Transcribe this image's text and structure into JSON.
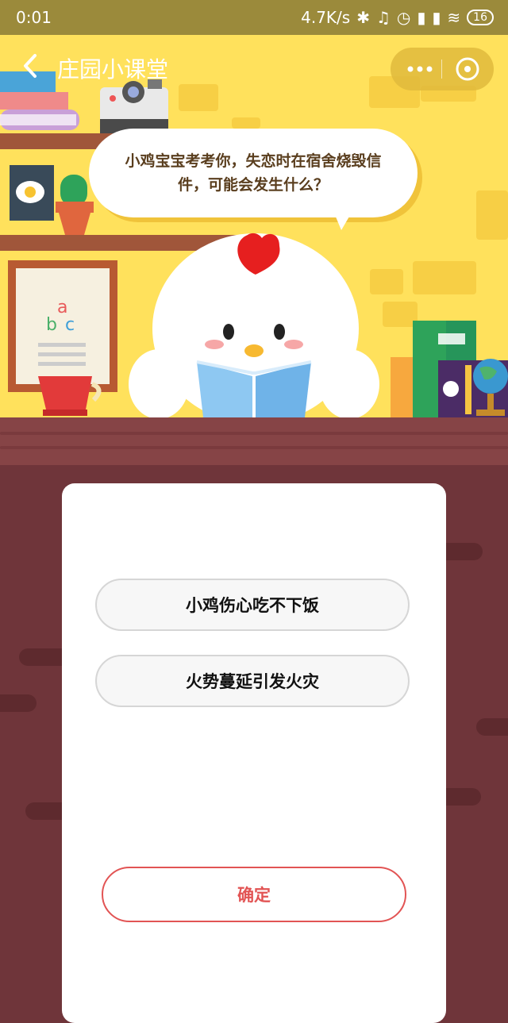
{
  "status_bar": {
    "time": "0:01",
    "network_speed": "4.7K/s",
    "battery": "16"
  },
  "nav": {
    "title": "庄园小课堂"
  },
  "question": {
    "text": "小鸡宝宝考考你，失恋时在宿舍烧毁信件，可能会发生什么？"
  },
  "options": [
    {
      "label": "小鸡伤心吃不下饭"
    },
    {
      "label": "火势蔓延引发火灾"
    }
  ],
  "confirm": {
    "label": "确定"
  },
  "decor": {
    "board_letters": [
      "a",
      "b",
      "c"
    ]
  },
  "colors": {
    "scene_bg": "#ffe15c",
    "wood": "#6f353a",
    "accent": "#e25454"
  }
}
